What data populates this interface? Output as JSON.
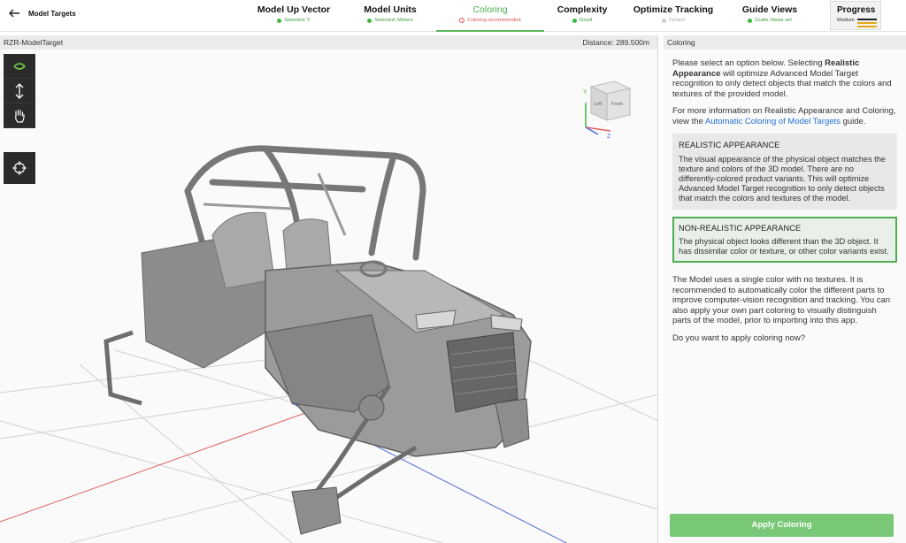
{
  "header": {
    "back_label": "Model Targets",
    "steps": [
      {
        "title": "Model Up Vector",
        "sub": "Selected: Y",
        "status": "ok"
      },
      {
        "title": "Model Units",
        "sub": "Selected: Meters",
        "status": "ok"
      },
      {
        "title": "Coloring",
        "sub": "Coloring recommended",
        "status": "warn"
      },
      {
        "title": "Complexity",
        "sub": "Good",
        "status": "ok"
      },
      {
        "title": "Optimize Tracking",
        "sub": "Default",
        "status": "muted"
      },
      {
        "title": "Guide Views",
        "sub": "Guide Views set",
        "status": "ok"
      }
    ],
    "progress": {
      "title": "Progress",
      "level": "Medium"
    }
  },
  "viewport": {
    "model_name": "RZR-ModelTarget",
    "distance": "Distance:  289.500m",
    "cube_labels": {
      "y": "Y",
      "z": "Z",
      "left": "Left",
      "front": "Front"
    }
  },
  "panel": {
    "title": "Coloring",
    "intro_1": "Please select an option below. Selecting ",
    "intro_bold": "Realistic Appearance",
    "intro_2": " will optimize Advanced Model Target recognition to only detect objects that match the colors and textures of the provided model.",
    "info_1": "For more information on Realistic Appearance and Coloring, view the ",
    "info_link": "Automatic Coloring of Model Targets",
    "info_2": " guide.",
    "option_realistic": {
      "title": "REALISTIC APPEARANCE",
      "desc": "The visual appearance of the physical object matches the texture and colors of the 3D model. There are no differently-colored product variants. This will optimize Advanced Model Target recognition to only detect objects that match the colors and textures of the model."
    },
    "option_nonrealistic": {
      "title": "NON-REALISTIC APPEARANCE",
      "desc": "The physical object looks different than the 3D object. It has dissimilar color or texture, or other color variants exist."
    },
    "note": "The Model uses a single color with no textures. It is recommended to automatically color the different parts to improve computer-vision recognition and tracking. You can also apply your own part coloring to visually distinguish parts of the model, prior to importing into this app.",
    "question": "Do you want to apply coloring now?",
    "apply_label": "Apply Coloring"
  },
  "colors": {
    "accent": "#4caf50",
    "warn": "#d9534f",
    "link": "#1e6fd6",
    "progress_bar": "#e6a817"
  }
}
